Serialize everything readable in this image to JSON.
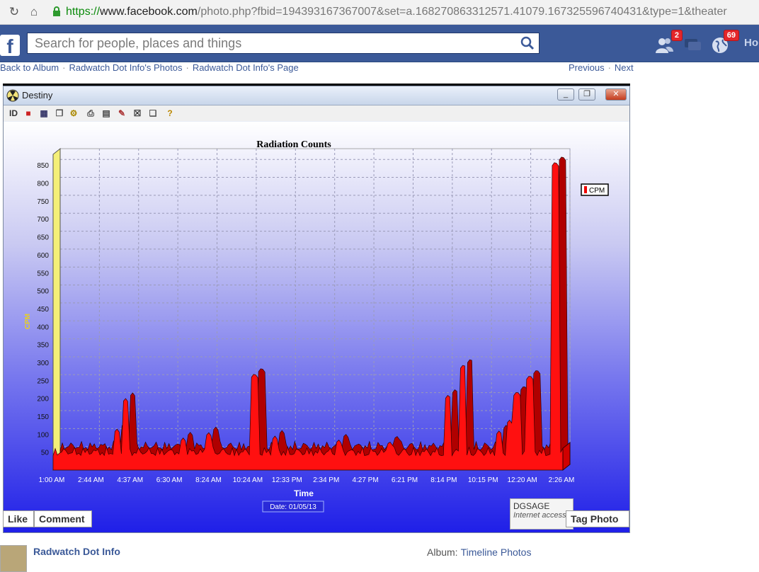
{
  "browser": {
    "url_scheme": "https://",
    "url_host": "www.facebook.com",
    "url_rest": "/photo.php?fbid=194393167367007&set=a.168270863312571.41079.167325596740431&type=1&theater"
  },
  "fb": {
    "logo": "f",
    "search_placeholder": "Search for people, places and things",
    "friend_requests_count": "2",
    "notifications_count": "69",
    "home_label": "Ho"
  },
  "crumbs": {
    "back": "Back to Album",
    "photos": "Radwatch Dot Info's Photos",
    "page": "Radwatch Dot Info's Page",
    "previous": "Previous",
    "next": "Next"
  },
  "app": {
    "title": "Destiny",
    "toolbar_id": "ID",
    "toolbar_help": "?"
  },
  "chart_data": {
    "type": "area",
    "title": "Radiation Counts",
    "xlabel": "Time",
    "ylabel": "CPM",
    "ylim": [
      0,
      880
    ],
    "yticks": [
      50,
      100,
      150,
      200,
      250,
      300,
      350,
      400,
      450,
      500,
      550,
      600,
      650,
      700,
      750,
      800,
      850
    ],
    "xticks": [
      "1:00 AM",
      "2:44 AM",
      "4:37 AM",
      "6:30 AM",
      "8:24 AM",
      "10:24 AM",
      "12:33 PM",
      "2:34 PM",
      "4:27 PM",
      "6:21 PM",
      "8:14 PM",
      "10:15 PM",
      "12:20 AM",
      "2:26 AM"
    ],
    "legend": "CPM",
    "legend_position": "right",
    "date_label": "Date: 01/05/13",
    "grid": true,
    "baseline": 40,
    "spikes": [
      {
        "x": 0.125,
        "y": 115
      },
      {
        "x": 0.142,
        "y": 200
      },
      {
        "x": 0.255,
        "y": 90
      },
      {
        "x": 0.305,
        "y": 105
      },
      {
        "x": 0.395,
        "y": 270
      },
      {
        "x": 0.435,
        "y": 95
      },
      {
        "x": 0.56,
        "y": 85
      },
      {
        "x": 0.66,
        "y": 80
      },
      {
        "x": 0.775,
        "y": 210
      },
      {
        "x": 0.805,
        "y": 295
      },
      {
        "x": 0.875,
        "y": 110
      },
      {
        "x": 0.895,
        "y": 140
      },
      {
        "x": 0.91,
        "y": 220
      },
      {
        "x": 0.935,
        "y": 265
      },
      {
        "x": 0.985,
        "y": 860
      }
    ]
  },
  "photo_actions": {
    "like": "Like",
    "comment": "Comment",
    "tag": "Tag Photo",
    "dgsage": "DGSAGE",
    "dgsage_sub": "Internet access"
  },
  "footer": {
    "page_name": "Radwatch Dot Info",
    "album_label": "Album:",
    "album_name": "Timeline Photos"
  }
}
